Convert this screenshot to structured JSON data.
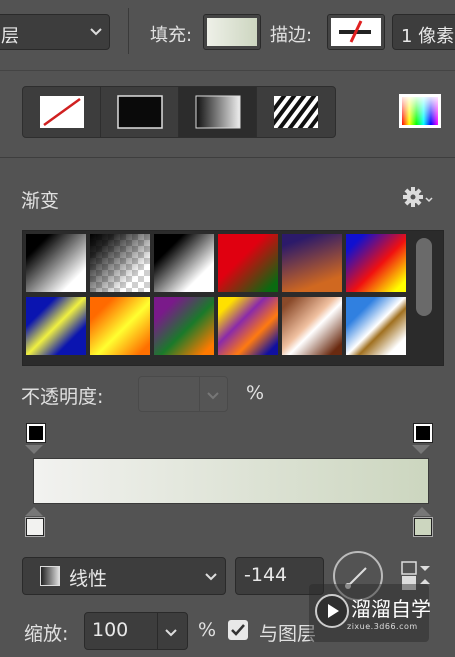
{
  "toolbar": {
    "layer_select_value": "层",
    "fill_label": "填充:",
    "stroke_label": "描边:",
    "stroke_width_value": "1 像素"
  },
  "fill_types": [
    "none",
    "solid-color",
    "gradient",
    "pattern"
  ],
  "gradient_panel": {
    "title": "渐变",
    "opacity_label": "不透明度:",
    "opacity_value": "",
    "opacity_unit": "%",
    "presets": [
      {
        "name": "black-white",
        "css": "linear-gradient(135deg,#000 0%,#000 20%,#fff 80%)"
      },
      {
        "name": "black-transparent",
        "css": "transparent-checker"
      },
      {
        "name": "black-white-2",
        "css": "linear-gradient(135deg,#000 25%,#fff 75%)"
      },
      {
        "name": "red-green",
        "css": "linear-gradient(135deg,#e00010 40%,#0a6a10 90%)"
      },
      {
        "name": "violet-orange",
        "css": "linear-gradient(160deg,#2c1a6a 15%,#d06820 80%)"
      },
      {
        "name": "blue-red-yellow",
        "css": "linear-gradient(135deg,#1010d0 15%,#f01010 55%,#ffff00 90%)"
      },
      {
        "name": "blue-yellow-blue",
        "css": "linear-gradient(135deg,#0a14b0 25%,#f0f040 50%,#0a14b0 75%)"
      },
      {
        "name": "orange-yellow-orange",
        "css": "linear-gradient(135deg,#ff6a00 20%,#ffff30 55%,#ff7000 90%)"
      },
      {
        "name": "violet-green-orange",
        "css": "linear-gradient(135deg,#7a1a8a 20%,#1a7a2a 55%,#ff7a00 90%)"
      },
      {
        "name": "yellow-violet-orange-blue",
        "css": "linear-gradient(135deg,#ffe000 15%,#8a2aaa 40%,#ff7a10 65%,#1010a0 90%)"
      },
      {
        "name": "copper",
        "css": "linear-gradient(135deg,#8a4a2a 10%,#f0c0a0 45%,#ffffff 55%,#6a2a10 90%)"
      },
      {
        "name": "chrome",
        "css": "linear-gradient(135deg,#3080e0 25%,#ffffff 50%,#a07020 60%,#ffffff 85%)"
      }
    ],
    "stops": {
      "opacity_left": "#000000",
      "opacity_right": "#000000",
      "color_left": "#f2f2f0",
      "color_right": "#ccd6bf"
    },
    "mode_label": "线性",
    "angle_value": "-144",
    "scale_label": "缩放:",
    "scale_value": "100",
    "scale_unit": "%",
    "align_with_layer_label": "与图层",
    "align_with_layer_checked": true
  },
  "watermark": {
    "text": "溜溜自学",
    "url": "zixue.3d66.com"
  }
}
